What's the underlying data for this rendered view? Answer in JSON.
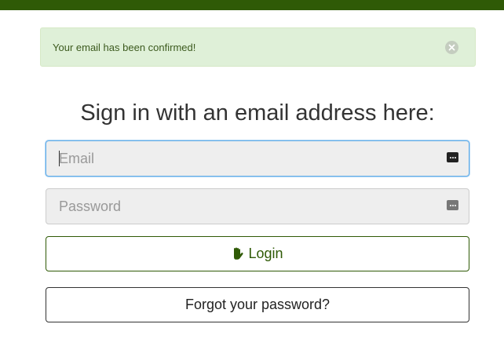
{
  "colors": {
    "brand": "#2f5a06",
    "alert_bg": "#dff0d8",
    "focus": "#66afe9"
  },
  "alert": {
    "message": "Your email has been confirmed!",
    "close_icon": "close-circle-icon"
  },
  "form": {
    "heading": "Sign in with an email address here:",
    "email": {
      "placeholder": "Email",
      "value": ""
    },
    "password": {
      "placeholder": "Password",
      "value": ""
    },
    "login": {
      "label": "Login",
      "icon": "hand-icon"
    },
    "forgot": {
      "label": "Forgot your password?"
    }
  }
}
